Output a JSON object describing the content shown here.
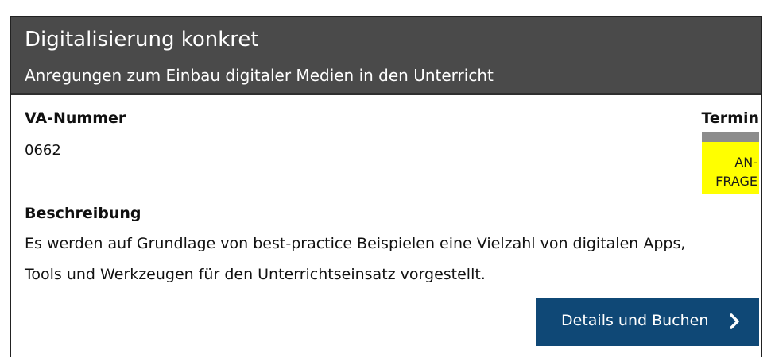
{
  "card": {
    "title": "Digitalisierung konkret",
    "subtitle": "Anregungen zum Einbau digitaler Medien in den Unterricht"
  },
  "va": {
    "label": "VA-Nummer",
    "value": "0662"
  },
  "termin": {
    "label": "Termin",
    "badge_text": "AN-\nFRAGE",
    "badge_color": "#ffff00"
  },
  "description": {
    "label": "Beschreibung",
    "text": "Es werden auf Grundlage von best-practice Beispielen eine Vielzahl von digitalen Apps, Tools und Werkzeugen für den Unterrichtseinsatz vorgestellt."
  },
  "actions": {
    "details_label": "Details und Buchen",
    "details_icon": "chevron-right-icon",
    "button_color": "#0f4876"
  }
}
